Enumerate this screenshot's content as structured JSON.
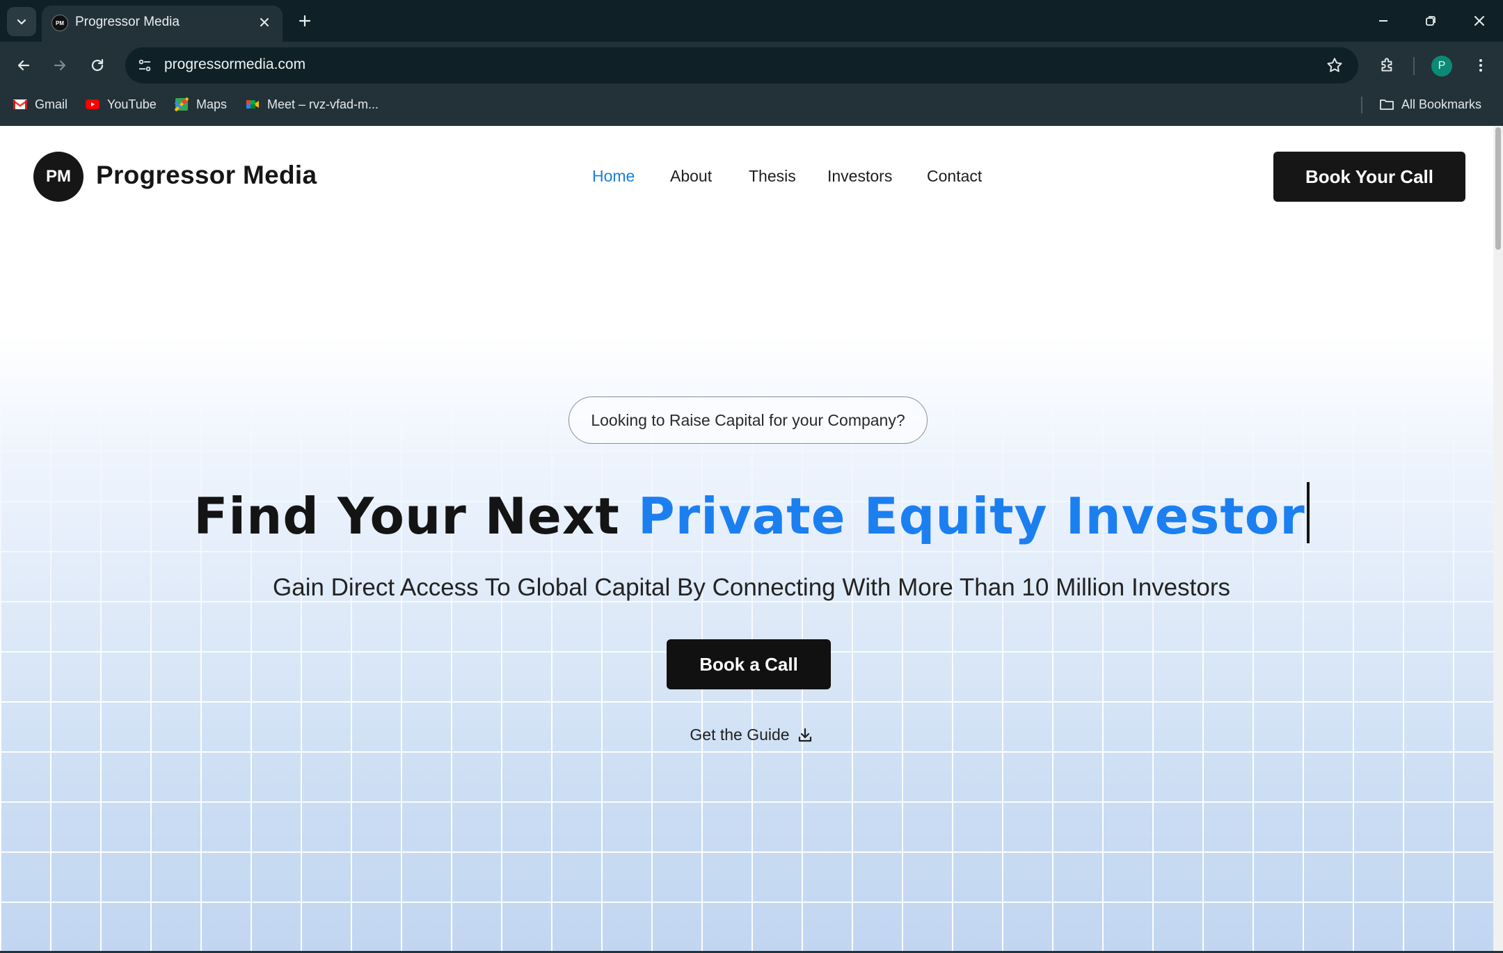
{
  "browser": {
    "tab_title": "Progressor Media",
    "tab_favicon_text": "PM",
    "url": "progressormedia.com",
    "profile_initial": "P",
    "bookmarks": [
      {
        "label": "Gmail",
        "icon": "gmail-icon"
      },
      {
        "label": "YouTube",
        "icon": "youtube-icon"
      },
      {
        "label": "Maps",
        "icon": "maps-icon"
      },
      {
        "label": "Meet – rvz-vfad-m...",
        "icon": "meet-icon"
      }
    ],
    "all_bookmarks_label": "All Bookmarks"
  },
  "site": {
    "logo_mark": "PM",
    "logo_text": "Progressor Media",
    "nav": [
      {
        "label": "Home",
        "active": true
      },
      {
        "label": "About",
        "active": false
      },
      {
        "label": "Thesis",
        "active": false
      },
      {
        "label": "Investors",
        "active": false
      },
      {
        "label": "Contact",
        "active": false
      }
    ],
    "header_cta": "Book Your Call"
  },
  "hero": {
    "pill_text": "Looking to Raise Capital for your Company?",
    "headline_prefix": "Find Your Next ",
    "headline_accent": "Private Equity Investor",
    "subheadline": "Gain Direct Access To Global Capital By Connecting With More Than 10 Million Investors",
    "cta_label": "Book a Call",
    "guide_label": "Get the Guide"
  },
  "colors": {
    "accent": "#1c7ff0",
    "nav_active": "#1a7fd9",
    "button_bg": "#161616",
    "chrome_bg": "#233238"
  }
}
